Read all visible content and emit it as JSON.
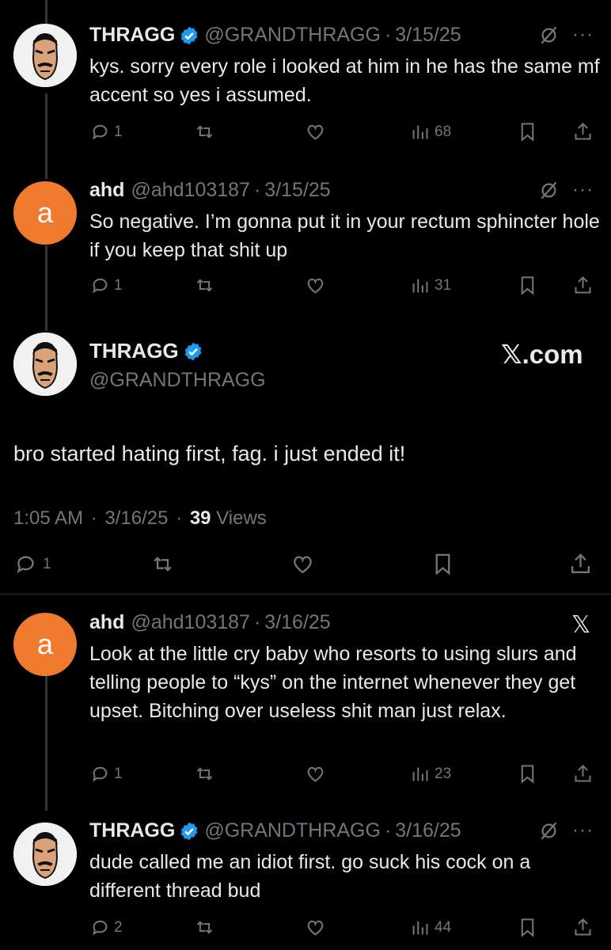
{
  "replies": [
    {
      "name": "THRAGG",
      "verified": true,
      "handle": "@GRANDTHRAGG",
      "sep": "·",
      "date": "3/15/25",
      "text": "kys. sorry every role i looked at him in he has the same mf accent so yes i assumed.",
      "stats": {
        "replies": "1",
        "views": "68"
      }
    },
    {
      "name": "ahd",
      "verified": false,
      "avatar_letter": "a",
      "handle": "@ahd103187",
      "sep": "·",
      "date": "3/15/25",
      "text": "So negative. I’m gonna put it in your rectum sphincter hole if you keep that shit up",
      "stats": {
        "replies": "1",
        "views": "31"
      }
    },
    {
      "name": "ahd",
      "verified": false,
      "avatar_letter": "a",
      "handle": "@ahd103187",
      "sep": "·",
      "date": "3/16/25",
      "text": "Look at the little cry baby who resorts to using slurs and telling people to “kys” on the internet whenever they get upset. Bitching over useless shit man just relax.",
      "stats": {
        "replies": "1",
        "views": "23"
      }
    },
    {
      "name": "THRAGG",
      "verified": true,
      "handle": "@GRANDTHRAGG",
      "sep": "·",
      "date": "3/16/25",
      "text": "dude called me an idiot first. go suck his cock on a different thread bud",
      "stats": {
        "replies": "2",
        "views": "44"
      }
    }
  ],
  "main": {
    "name": "THRAGG",
    "handle": "@GRANDTHRAGG",
    "brand": "𝕏.com",
    "text": "bro started hating first, fag. i just ended it!",
    "time": "1:05 AM",
    "date": "3/16/25",
    "sep": "·",
    "views_count": "39",
    "views_label": "Views",
    "stats": {
      "replies": "1"
    }
  },
  "more_label": "···",
  "x_glyph": "𝕏",
  "colors": {
    "background": "#000000",
    "text": "#e7e9ea",
    "muted": "#71767b",
    "verified": "#1d9bf0",
    "avatar_a": "#f07b2e"
  },
  "icons": [
    "reply-icon",
    "retweet-icon",
    "like-icon",
    "views-icon",
    "bookmark-icon",
    "share-icon",
    "grok-icon",
    "verified-badge-icon",
    "x-logo-icon"
  ]
}
